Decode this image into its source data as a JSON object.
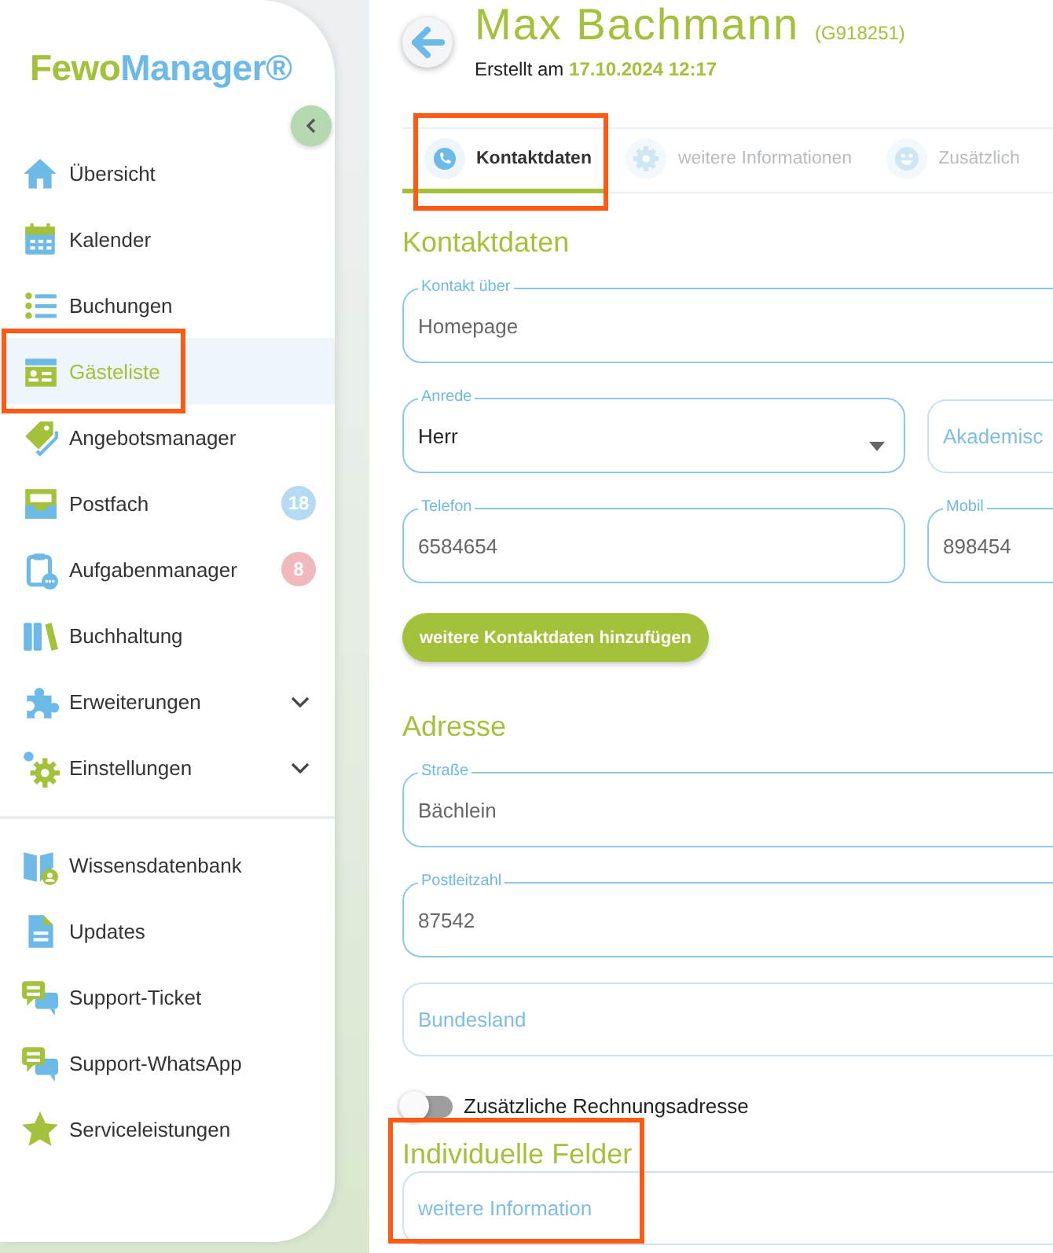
{
  "logo": {
    "parts": [
      {
        "text": "Fewo",
        "color": "#a3c13a"
      },
      {
        "text": "Manager®",
        "color": "#6db9e8"
      }
    ]
  },
  "sidebar": {
    "items": [
      {
        "label": "Übersicht",
        "selected": false,
        "highlighted": false
      },
      {
        "label": "Kalender",
        "selected": false,
        "highlighted": false
      },
      {
        "label": "Buchungen",
        "selected": false,
        "highlighted": false
      },
      {
        "label": "Gästeliste",
        "selected": true,
        "highlighted": true
      },
      {
        "label": "Angebotsmanager",
        "selected": false,
        "highlighted": false
      },
      {
        "label": "Postfach",
        "selected": false,
        "highlighted": false,
        "badge": {
          "text": "18",
          "color": "#b5dbf2"
        }
      },
      {
        "label": "Aufgabenmanager",
        "selected": false,
        "highlighted": false,
        "badge": {
          "text": "8",
          "color": "#f1b9bb"
        }
      },
      {
        "label": "Buchhaltung",
        "selected": false,
        "highlighted": false
      },
      {
        "label": "Erweiterungen",
        "selected": false,
        "highlighted": false,
        "expanded": false
      },
      {
        "label": "Einstellungen",
        "selected": false,
        "highlighted": false,
        "expanded": false
      }
    ],
    "footer_items": [
      {
        "label": "Wissensdatenbank"
      },
      {
        "label": "Updates"
      },
      {
        "label": "Support-Ticket"
      },
      {
        "label": "Support-WhatsApp"
      },
      {
        "label": "Serviceleistungen"
      }
    ]
  },
  "header": {
    "name": "Max Bachmann",
    "guest_id": "(G918251)",
    "created_label": "Erstellt am",
    "created_at": "17.10.2024 12:17"
  },
  "tabs": [
    {
      "label": "Kontaktdaten",
      "selected": true,
      "highlighted": true
    },
    {
      "label": "weitere Informationen",
      "selected": false,
      "highlighted": false
    },
    {
      "label": "Zusätzlich",
      "selected": false,
      "highlighted": false
    }
  ],
  "sections": [
    {
      "title": "Kontaktdaten",
      "highlighted": false,
      "items": [
        {
          "kind": "row",
          "fields": [
            {
              "label": "Kontakt über",
              "value": "Homepage"
            }
          ]
        },
        {
          "kind": "row",
          "fields": [
            {
              "label": "Anrede",
              "value": "Herr",
              "dropdown": true
            },
            {
              "placeholder": "Akademisc"
            }
          ]
        },
        {
          "kind": "row",
          "fields": [
            {
              "label": "Telefon",
              "value": "6584654"
            },
            {
              "label": "Mobil",
              "value": "898454"
            }
          ]
        },
        {
          "kind": "button",
          "label": "weitere Kontaktdaten hinzufügen"
        }
      ]
    },
    {
      "title": "Adresse",
      "highlighted": false,
      "items": [
        {
          "kind": "row",
          "fields": [
            {
              "label": "Straße",
              "value": "Bächlein"
            }
          ]
        },
        {
          "kind": "row",
          "fields": [
            {
              "label": "Postleitzahl",
              "value": "87542"
            }
          ]
        },
        {
          "kind": "row",
          "fields": [
            {
              "placeholder": "Bundesland"
            }
          ]
        },
        {
          "kind": "toggle",
          "label": "Zusätzliche Rechnungsadresse",
          "on": false
        }
      ]
    },
    {
      "title": "Individuelle Felder",
      "highlighted": true,
      "items": [
        {
          "kind": "row",
          "fields": [
            {
              "placeholder": "weitere Information"
            }
          ]
        }
      ]
    }
  ]
}
